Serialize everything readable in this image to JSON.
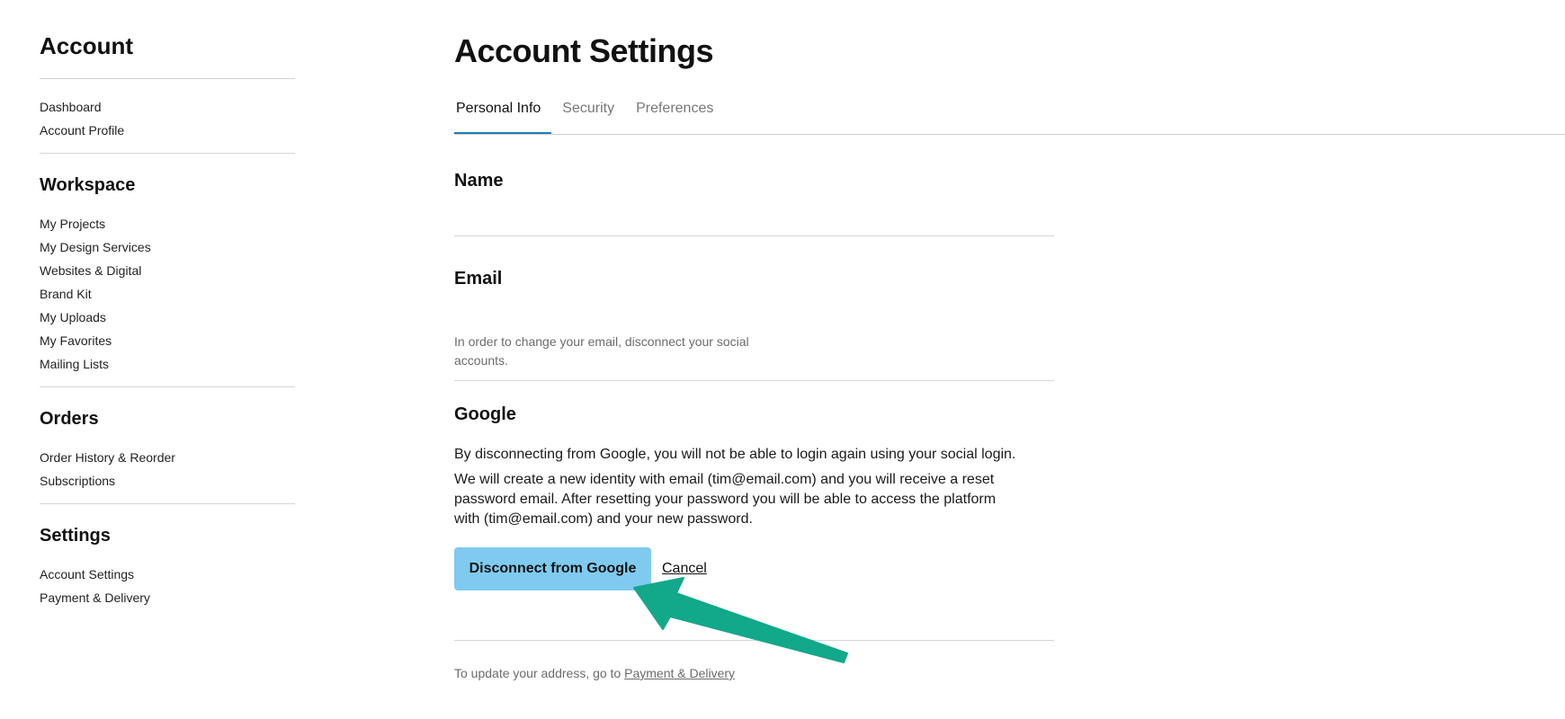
{
  "sidebar": {
    "title": "Account",
    "account_items": [
      "Dashboard",
      "Account Profile"
    ],
    "sections": [
      {
        "heading": "Workspace",
        "items": [
          "My Projects",
          "My Design Services",
          "Websites & Digital",
          "Brand Kit",
          "My Uploads",
          "My Favorites",
          "Mailing Lists"
        ]
      },
      {
        "heading": "Orders",
        "items": [
          "Order History & Reorder",
          "Subscriptions"
        ]
      },
      {
        "heading": "Settings",
        "items": [
          "Account Settings",
          "Payment & Delivery"
        ]
      }
    ]
  },
  "main": {
    "title": "Account Settings",
    "tabs": [
      "Personal Info",
      "Security",
      "Preferences"
    ],
    "active_tab": "Personal Info",
    "name_label": "Name",
    "email_label": "Email",
    "email_note": "In order to change your email, disconnect your social accounts.",
    "google_label": "Google",
    "google_text_1": "By disconnecting from Google, you will not be able to login again using your social login.",
    "google_text_2": "We will create a new identity with email (tim@email.com)  and you will receive a reset password email. After resetting your password you will be able to access the platform with  (tim@email.com)  and your new password.",
    "disconnect_button": "Disconnect from Google",
    "cancel_link": "Cancel",
    "address_note_prefix": "To update your address, go to ",
    "address_note_link": "Payment & Delivery"
  },
  "colors": {
    "button_bg": "#7fcbef",
    "tab_active_underline": "#1f7fb5",
    "annotation_arrow": "#12a88a"
  },
  "icons": {
    "annotation": "arrow-pointing-to-disconnect-button"
  }
}
